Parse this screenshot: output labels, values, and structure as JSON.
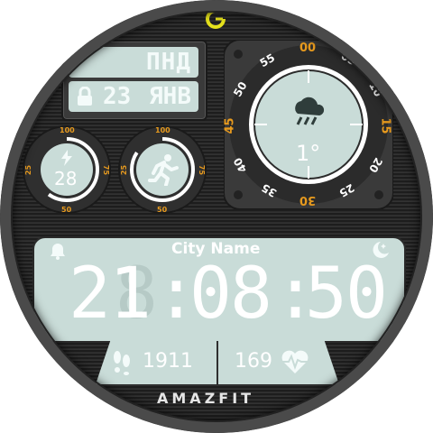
{
  "brand": "AMAZFIT",
  "top_icon": "charge-ring-icon",
  "date": {
    "weekday": "ПНД",
    "day": "23",
    "month": "ЯНВ"
  },
  "weather": {
    "temperature": "1°",
    "icon": "rain-cloud-icon",
    "bezel": [
      "00",
      "05",
      "10",
      "15",
      "20",
      "25",
      "30",
      "35",
      "40",
      "45",
      "50",
      "55"
    ]
  },
  "battery": {
    "value": "28",
    "scale": [
      "100",
      "75",
      "50",
      "25"
    ],
    "icon": "bolt-icon"
  },
  "activity": {
    "icon": "runner-icon",
    "scale": [
      "100",
      "75",
      "50",
      "25"
    ]
  },
  "city": "City Name",
  "time": {
    "hh": "21",
    "mm": "08",
    "ss": "50",
    "ghost_digit": "8"
  },
  "steps": {
    "value": "1911",
    "icon": "footprints-icon"
  },
  "heart_rate": {
    "value": "169",
    "icon": "heart-pulse-icon"
  },
  "colors": {
    "accent": "#e79a1e",
    "lcd": "#c9dcd8",
    "text": "#f4fbfa"
  }
}
